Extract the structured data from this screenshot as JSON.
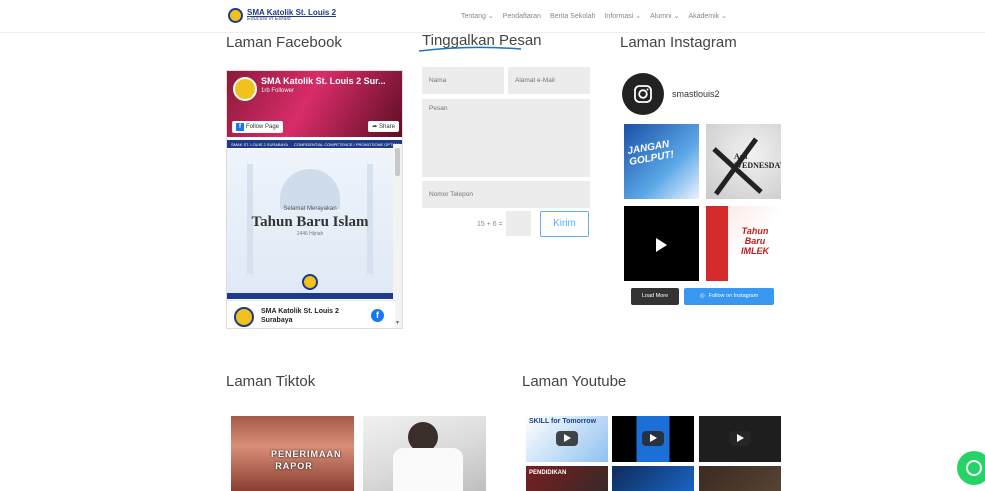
{
  "header": {
    "brand_name": "SMA Katolik St. Louis 2",
    "brand_tagline": "Educare in Ebraio",
    "nav": [
      {
        "label": "Tentang",
        "dropdown": true
      },
      {
        "label": "Pendaftaran",
        "dropdown": false
      },
      {
        "label": "Berita Sekolah",
        "dropdown": false
      },
      {
        "label": "Informasi",
        "dropdown": true
      },
      {
        "label": "Alumni",
        "dropdown": true
      },
      {
        "label": "Akademik",
        "dropdown": true
      }
    ]
  },
  "facebook": {
    "title": "Laman Facebook",
    "page_name": "SMA Katolik St. Louis 2 Sur...",
    "followers": "1rb Follower",
    "follow_label": "Follow Page",
    "share_label": "Share",
    "strip": [
      "SMAK ST. LOUIS 2 SURABAYA",
      "CONFIDENTIAL COMPETENCE / PROMOTIONE OPTIMA"
    ],
    "post_subtitle": "Selamat Merayakan",
    "post_title": "Tahun Baru Islam",
    "post_hijri": "1446 Hijriah",
    "bottom_name": "SMA Katolik St. Louis 2 Surabaya",
    "f_icon": "f"
  },
  "contact": {
    "title": "Tinggalkan Pesan",
    "name_placeholder": "Nama",
    "email_placeholder": "Alamat e-Mail",
    "message_placeholder": "Pesan",
    "phone_placeholder": "Nomor Telepon",
    "captcha": "15 + 6 =",
    "submit_label": "Kirim",
    "accent": "#1e73be"
  },
  "instagram": {
    "title": "Laman Instagram",
    "username": "smastlouis2",
    "tiles": [
      {
        "text": "JANGAN GOLPUT!"
      },
      {
        "text": "Ash WEDNESDAY"
      },
      {
        "text": ""
      },
      {
        "text": "Tahun Baru IMLEK"
      }
    ],
    "load_more": "Load More",
    "follow_label": "Follow on Instagram"
  },
  "tiktok": {
    "title": "Laman Tiktok",
    "tiles": [
      {
        "text": "PENERIMAAN RAPOR"
      },
      {
        "text": ""
      }
    ]
  },
  "youtube": {
    "title": "Laman Youtube",
    "tiles": [
      {
        "text": "SKILL for Tomorrow"
      },
      {
        "text": ""
      },
      {
        "text": ""
      },
      {
        "text": "PENDIDIKAN"
      },
      {
        "text": ""
      },
      {
        "text": ""
      }
    ]
  }
}
